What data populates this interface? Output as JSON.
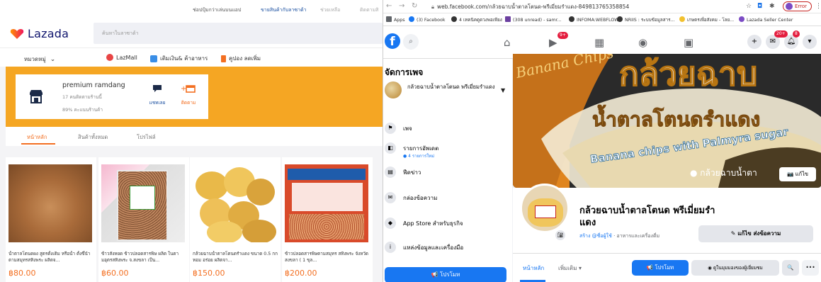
{
  "lazada": {
    "topbar": {
      "links": [
        "ช่อปปุ้มกว่าเล่นบนแอป",
        "ขายสินค้ากับลาซาด้า",
        "ช่วยเหลือ",
        "ติดตามสิ"
      ]
    },
    "brand": {
      "name": "Lazada",
      "color": "#0f146d",
      "accent": "#f36f21"
    },
    "search": {
      "placeholder": "ค้นหาในลาซาด้า"
    },
    "nav": {
      "category_label": "หมวดหมู่",
      "links": [
        {
          "label": "LazMall",
          "icon": "lazmall-icon",
          "color": "#e84545"
        },
        {
          "label": "เติมเงิน& ค้าอาหาร",
          "icon": "topup-icon",
          "color": "#3a8ee6"
        },
        {
          "label": "คูปอง ลดเพิ่ม",
          "icon": "coupon-icon",
          "color": "#f36f21"
        }
      ]
    },
    "store": {
      "name": "premium ramdang",
      "followers": "17 คนติดตามร้านนี้",
      "rating": "89% คะแนนร้านค้า",
      "chat_label": "แชทเลย",
      "follow_label": "ติดตาม",
      "banner_color": "#f5a623"
    },
    "tabs": [
      {
        "label": "หน้าหลัก",
        "active": true
      },
      {
        "label": "สินค้าทั้งหมด",
        "active": false
      },
      {
        "label": "โปรไฟล์",
        "active": false
      }
    ],
    "products": [
      {
        "name": "น้ำตาลโตนดผง สูตรดั้งเดิม หรือน้ำ ตั้งขึ้นำ ตามสมุทรสทิงพระ ผลิตจ...",
        "price": "฿80.00"
      },
      {
        "name": "ข้าวสังหยด ข้าวปลอดสารพิษ ผลิต ในตามอุตรสทิงพระ จ.สงขลา เป็น...",
        "price": "฿60.00"
      },
      {
        "name": "กล้วยฉาบน้ำตาลโตนดรำแดง ขนาด 0.5 กก หอม อร่อย ผลิตจา...",
        "price": "฿150.00"
      },
      {
        "name": "ข้าวปลอดสารพิษตามสมุทร สทิงพระ จังหวัดสงขลา ( 1 ขุล...",
        "price": "฿200.00"
      }
    ]
  },
  "browser": {
    "url": "web.facebook.com/กล้วยฉาบน้ำตาลโตนด-พรีเมี่ยมรำแดง-849813765358854",
    "error_label": "Error",
    "bookmarks": [
      {
        "label": "Apps",
        "color": "#5f6368"
      },
      {
        "label": "(3) Facebook",
        "color": "#1877f2"
      },
      {
        "label": "4 เทคนิคดูดวงพอเพียง",
        "color": "#333"
      },
      {
        "label": "(308 unread) - samr...",
        "color": "#6b3fa0"
      },
      {
        "label": "INFOMA:WEBFLOW",
        "color": "#333"
      },
      {
        "label": "NRIIS : ระบบข้อมูลสาร...",
        "color": "#333"
      },
      {
        "label": "เกษตรเพื่อสังคม - โลย...",
        "color": "#f2c12e"
      },
      {
        "label": "Lazada Seller Center",
        "color": "#7b4bc4"
      }
    ]
  },
  "facebook": {
    "badges": {
      "watch": "9+",
      "messenger": "20+",
      "notifications": "8"
    },
    "sidebar": {
      "title": "จัดการเพจ",
      "page_name": "กล้วยฉาบน้ำตาลโตนด พรีเมี่ยมรำแดง",
      "items": [
        {
          "label": "เพจ",
          "icon": "flag-icon",
          "sub": ""
        },
        {
          "label": "รายการอัพเดต",
          "icon": "updates-icon",
          "sub": "● 4 รายการใหม่"
        },
        {
          "label": "ฟีดข่าว",
          "icon": "news-feed-icon",
          "sub": ""
        },
        {
          "label": "กล่องข้อความ",
          "icon": "inbox-icon",
          "sub": ""
        },
        {
          "label": "App Store สำหรับธุรกิจ",
          "icon": "app-store-icon",
          "sub": ""
        },
        {
          "label": "แหล่งข้อมูลและเครื่องมือ",
          "icon": "info-icon",
          "sub": ""
        }
      ],
      "promote_label": "📢 โปรโมท"
    },
    "cover": {
      "text_top": "Banana Chips",
      "text_big": "กล้วยฉาบ",
      "text_mid": "น้ำตาลโตนดรำแดง",
      "text_en": "Banana chips with Palmyra sugar",
      "text_small": "● กล้วยฉาบน้ำตา",
      "edit_label": "📷 แก้ไข"
    },
    "profile": {
      "name": "กล้วยฉาบน้ำตาลโตนด พรีเมี่ยมรำแดง",
      "create_label": "สร้าง @ชื่อผู้ใช้",
      "category": " · อาหารและเครื่องดื่ม",
      "edit_message_label": "✎ แก้ไข ส่งข้อความ"
    },
    "page_tabs": [
      {
        "label": "หน้าหลัก",
        "active": true
      },
      {
        "label": "เพิ่มเติม ▾",
        "active": false
      }
    ],
    "actions": {
      "promote": "📢 โปรโมท",
      "view_as": "◉ ดูในมุมมองของผู้เยี่ยมชม",
      "search": "🔍"
    },
    "accent_color": "#1877f2"
  }
}
